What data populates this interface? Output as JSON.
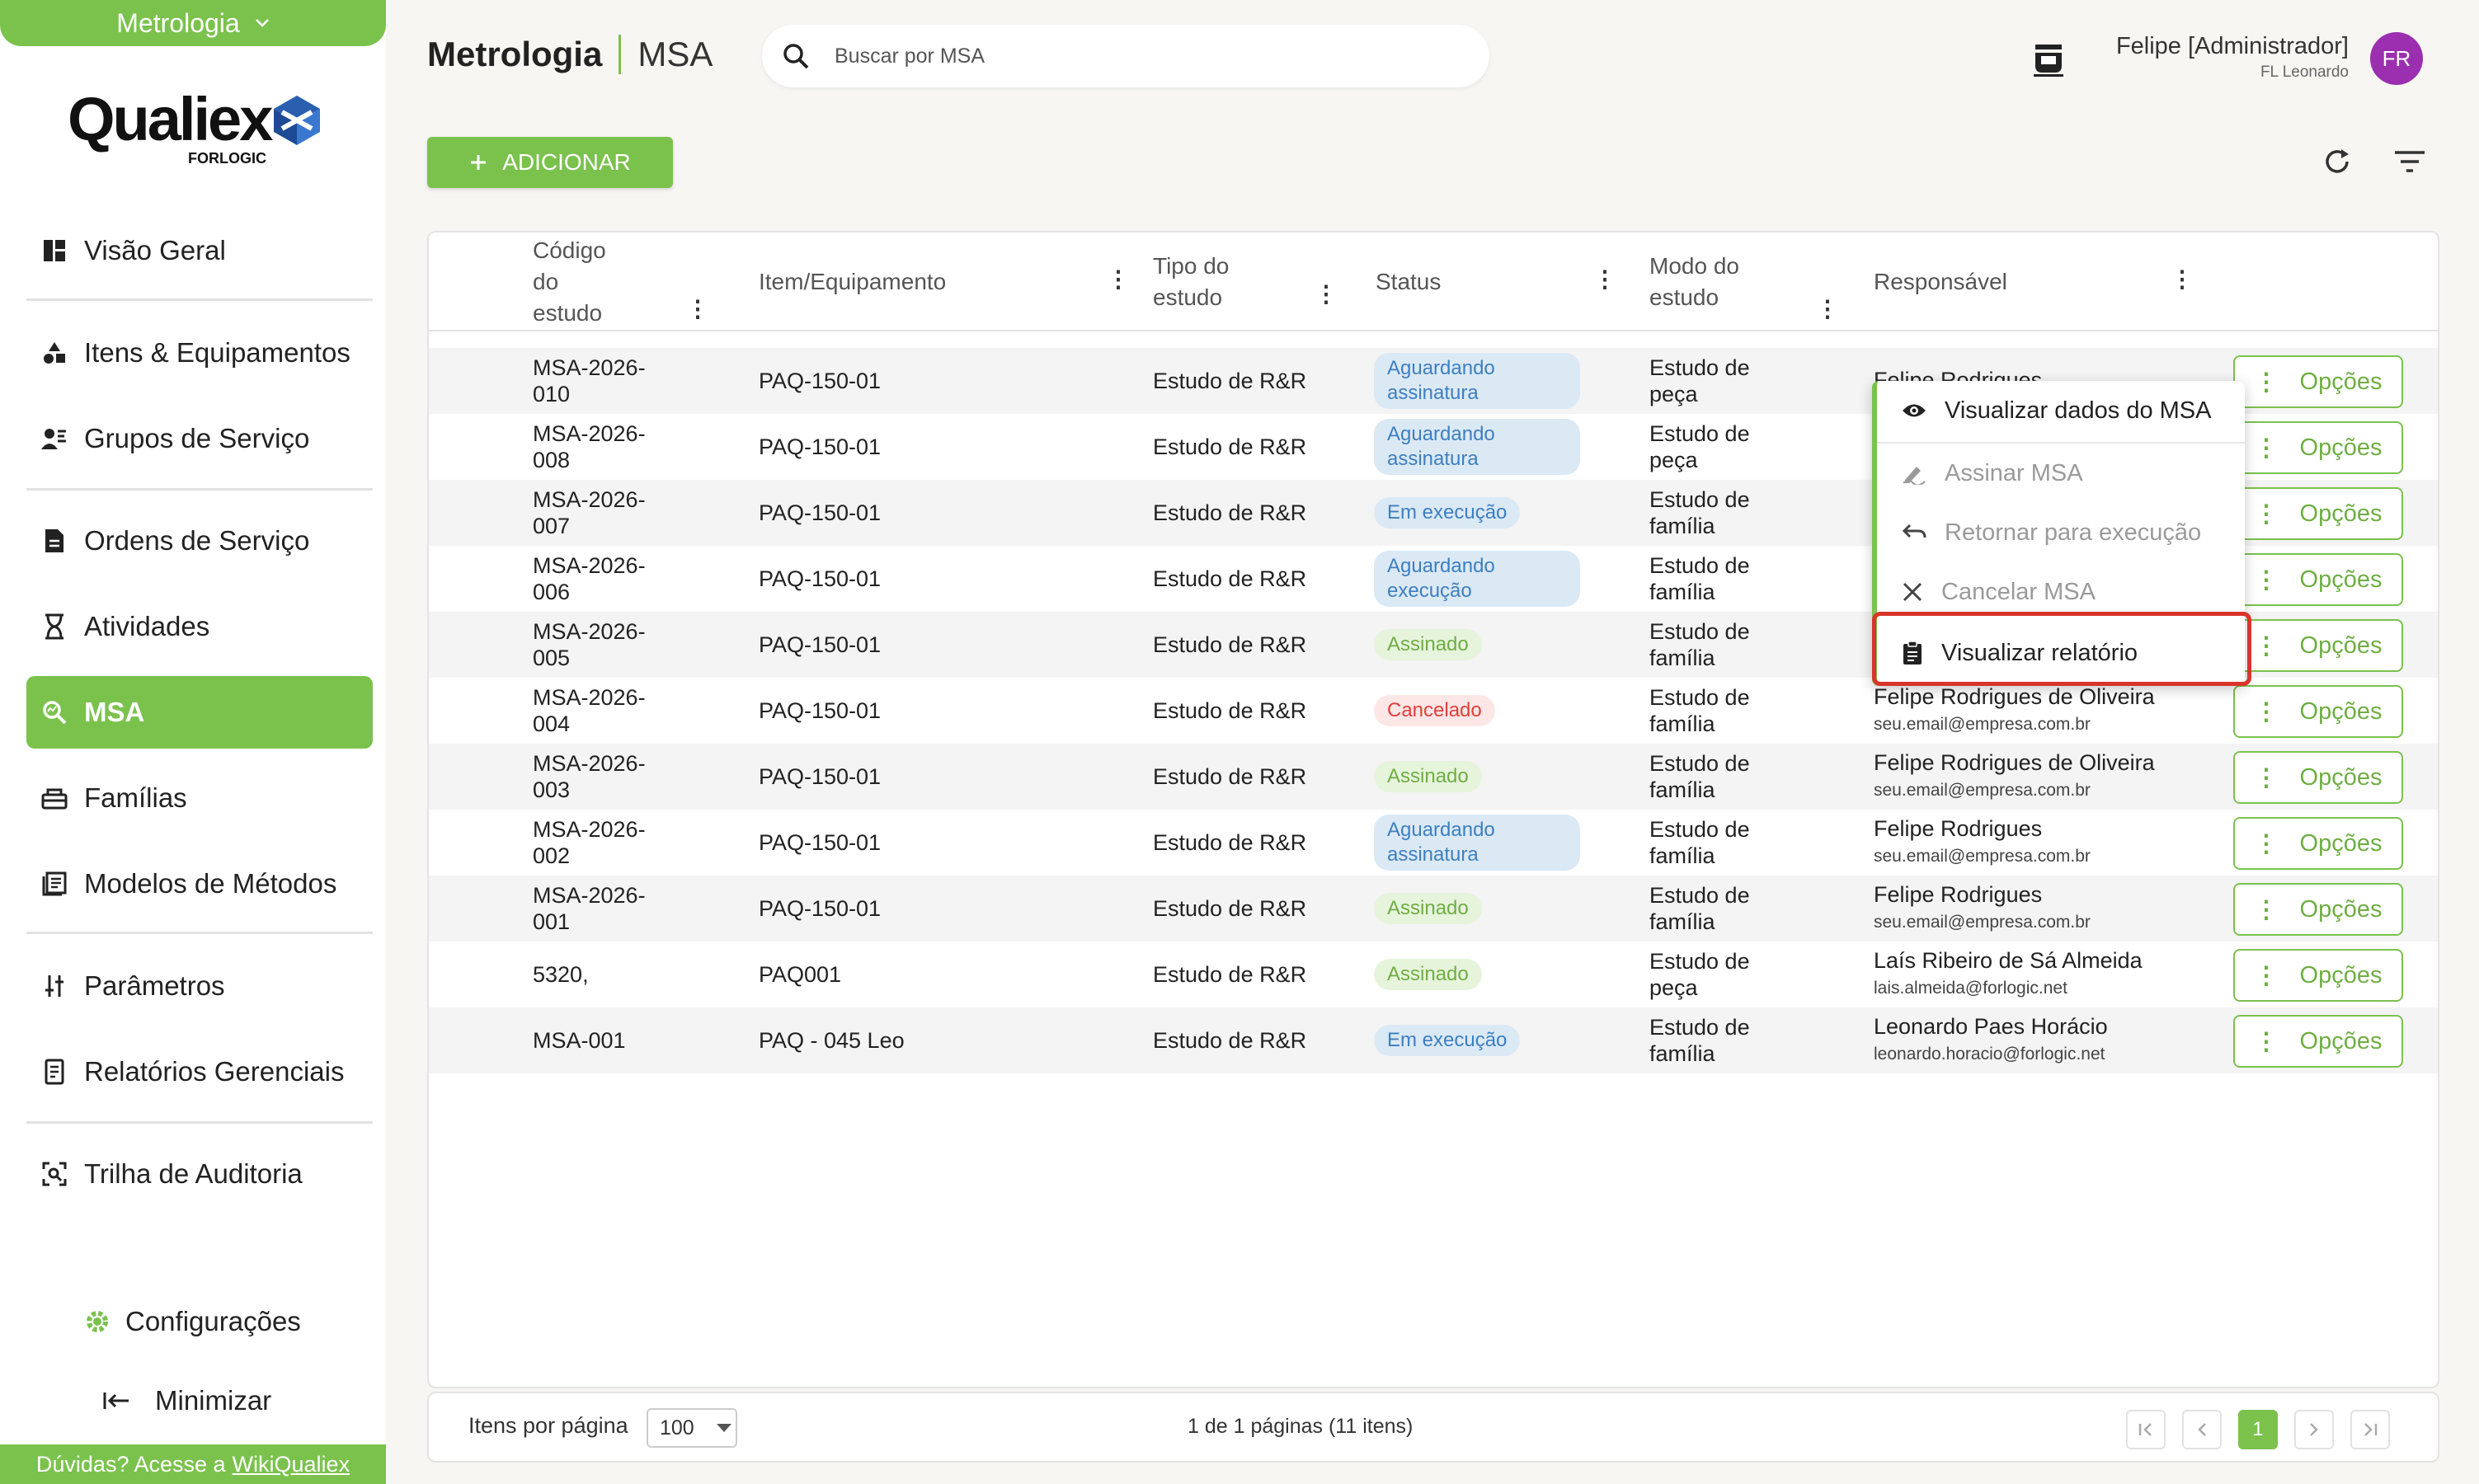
{
  "sidebar": {
    "module": "Metrologia",
    "logo_main": "Qualiex",
    "logo_sub": "FORLOGIC",
    "items": [
      {
        "label": "Visão Geral",
        "icon": "dashboard-icon"
      },
      {
        "label": "Itens & Equipamentos",
        "icon": "shapes-icon"
      },
      {
        "label": "Grupos de Serviço",
        "icon": "group-icon"
      },
      {
        "label": "Ordens de Serviço",
        "icon": "document-icon"
      },
      {
        "label": "Atividades",
        "icon": "hourglass-icon"
      },
      {
        "label": "MSA",
        "icon": "msa-search-icon"
      },
      {
        "label": "Famílias",
        "icon": "family-icon"
      },
      {
        "label": "Modelos de Métodos",
        "icon": "book-icon"
      },
      {
        "label": "Parâmetros",
        "icon": "sliders-icon"
      },
      {
        "label": "Relatórios Gerenciais",
        "icon": "report-icon"
      },
      {
        "label": "Trilha de Auditoria",
        "icon": "audit-icon"
      }
    ],
    "config_label": "Configurações",
    "minimize_label": "Minimizar",
    "help_text": "Dúvidas? Acesse a",
    "help_link": "WikiQualiex"
  },
  "header": {
    "title": "Metrologia",
    "subtitle": "MSA",
    "search_placeholder": "Buscar por MSA",
    "user_name": "Felipe [Administrador]",
    "user_company": "FL Leonardo",
    "avatar_initials": "FR"
  },
  "toolbar": {
    "add_label": "ADICIONAR"
  },
  "table": {
    "columns": [
      "Código do estudo",
      "Item/Equipamento",
      "Tipo do estudo",
      "Status",
      "Modo do estudo",
      "Responsável"
    ],
    "options_label": "Opções",
    "rows": [
      {
        "code": "MSA-2026-010",
        "item": "PAQ-150-01",
        "type": "Estudo de R&R",
        "status": "Aguardando assinatura",
        "status_kind": "blue",
        "mode": "Estudo de peça",
        "resp_name": "Felipe Rodrigues",
        "resp_email": ""
      },
      {
        "code": "MSA-2026-008",
        "item": "PAQ-150-01",
        "type": "Estudo de R&R",
        "status": "Aguardando assinatura",
        "status_kind": "blue",
        "mode": "Estudo de peça",
        "resp_name": "",
        "resp_email": ""
      },
      {
        "code": "MSA-2026-007",
        "item": "PAQ-150-01",
        "type": "Estudo de R&R",
        "status": "Em execução",
        "status_kind": "blue",
        "mode": "Estudo de família",
        "resp_name": "",
        "resp_email": ""
      },
      {
        "code": "MSA-2026-006",
        "item": "PAQ-150-01",
        "type": "Estudo de R&R",
        "status": "Aguardando execução",
        "status_kind": "blue",
        "mode": "Estudo de família",
        "resp_name": "",
        "resp_email": ""
      },
      {
        "code": "MSA-2026-005",
        "item": "PAQ-150-01",
        "type": "Estudo de R&R",
        "status": "Assinado",
        "status_kind": "green",
        "mode": "Estudo de família",
        "resp_name": "",
        "resp_email": ""
      },
      {
        "code": "MSA-2026-004",
        "item": "PAQ-150-01",
        "type": "Estudo de R&R",
        "status": "Cancelado",
        "status_kind": "red",
        "mode": "Estudo de família",
        "resp_name": "Felipe Rodrigues de Oliveira",
        "resp_email": "seu.email@empresa.com.br"
      },
      {
        "code": "MSA-2026-003",
        "item": "PAQ-150-01",
        "type": "Estudo de R&R",
        "status": "Assinado",
        "status_kind": "green",
        "mode": "Estudo de família",
        "resp_name": "Felipe Rodrigues de Oliveira",
        "resp_email": "seu.email@empresa.com.br"
      },
      {
        "code": "MSA-2026-002",
        "item": "PAQ-150-01",
        "type": "Estudo de R&R",
        "status": "Aguardando assinatura",
        "status_kind": "blue",
        "mode": "Estudo de família",
        "resp_name": "Felipe Rodrigues",
        "resp_email": "seu.email@empresa.com.br"
      },
      {
        "code": "MSA-2026-001",
        "item": "PAQ-150-01",
        "type": "Estudo de R&R",
        "status": "Assinado",
        "status_kind": "green",
        "mode": "Estudo de família",
        "resp_name": "Felipe Rodrigues",
        "resp_email": "seu.email@empresa.com.br"
      },
      {
        "code": "5320,",
        "item": "PAQ001",
        "type": "Estudo de R&R",
        "status": "Assinado",
        "status_kind": "green",
        "mode": "Estudo de peça",
        "resp_name": "Laís Ribeiro de Sá Almeida",
        "resp_email": "lais.almeida@forlogic.net"
      },
      {
        "code": "MSA-001",
        "item": "PAQ - 045 Leo",
        "type": "Estudo de R&R",
        "status": "Em execução",
        "status_kind": "blue",
        "mode": "Estudo de família",
        "resp_name": "Leonardo Paes Horácio",
        "resp_email": "leonardo.horacio@forlogic.net"
      }
    ]
  },
  "context_menu": {
    "items": [
      {
        "label": "Visualizar dados do MSA",
        "icon": "eye-icon",
        "disabled": false
      },
      {
        "label": "Assinar MSA",
        "icon": "signature-icon",
        "disabled": true
      },
      {
        "label": "Retornar para execução",
        "icon": "undo-icon",
        "disabled": true
      },
      {
        "label": "Cancelar MSA",
        "icon": "close-icon",
        "disabled": true
      },
      {
        "label": "Visualizar relatório",
        "icon": "clipboard-icon",
        "disabled": false
      }
    ]
  },
  "footer": {
    "per_page_label": "Itens por página",
    "per_page_value": "100",
    "page_info": "1 de 1 páginas (11 itens)",
    "current_page": "1"
  },
  "colors": {
    "accent": "#7bc24d",
    "highlight": "#d9342b",
    "avatar": "#9b2fb0"
  }
}
